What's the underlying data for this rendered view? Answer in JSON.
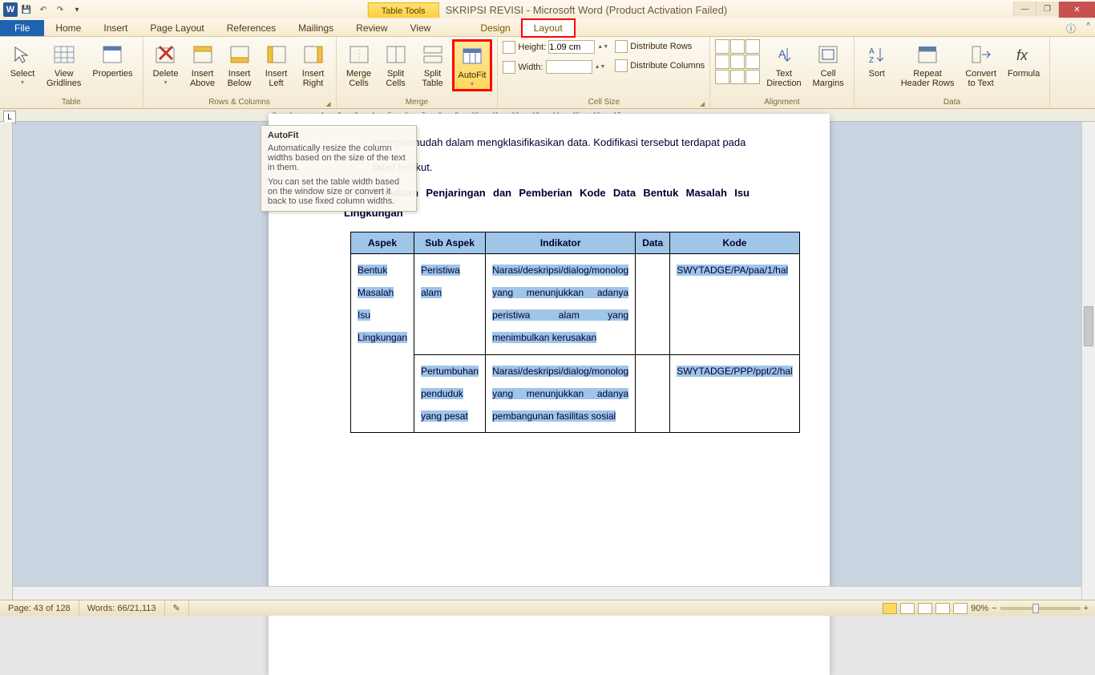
{
  "titlebar": {
    "table_tools": "Table Tools",
    "doc_title": "SKRIPSI REVISI  -  Microsoft Word (Product Activation Failed)"
  },
  "tabs": {
    "file": "File",
    "home": "Home",
    "insert": "Insert",
    "page_layout": "Page Layout",
    "references": "References",
    "mailings": "Mailings",
    "review": "Review",
    "view": "View",
    "design": "Design",
    "layout": "Layout"
  },
  "ribbon": {
    "table": {
      "select": "Select",
      "view_gridlines": "View\nGridlines",
      "properties": "Properties",
      "group": "Table"
    },
    "rows_cols": {
      "delete": "Delete",
      "insert_above": "Insert\nAbove",
      "insert_below": "Insert\nBelow",
      "insert_left": "Insert\nLeft",
      "insert_right": "Insert\nRight",
      "group": "Rows & Columns"
    },
    "merge": {
      "merge_cells": "Merge\nCells",
      "split_cells": "Split\nCells",
      "split_table": "Split\nTable",
      "autofit": "AutoFit",
      "group": "Merge"
    },
    "cell_size": {
      "height_lbl": "Height:",
      "height_val": "1.09 cm",
      "width_lbl": "Width:",
      "width_val": "",
      "dist_rows": "Distribute Rows",
      "dist_cols": "Distribute Columns",
      "group": "Cell Size"
    },
    "alignment": {
      "text_direction": "Text\nDirection",
      "cell_margins": "Cell\nMargins",
      "group": "Alignment"
    },
    "data": {
      "sort": "Sort",
      "repeat_header": "Repeat\nHeader Rows",
      "convert": "Convert\nto Text",
      "formula": "Formula",
      "group": "Data"
    }
  },
  "tooltip": {
    "title": "AutoFit",
    "p1": "Automatically resize the column widths based on the size of the text in them.",
    "p2": "You can set the table width based on the window size or convert it back to use fixed column widths."
  },
  "document": {
    "para1": "mempermudah dalam mengklasifikasikan data. Kodifikasi tersebut terdapat pada",
    "para2": "tabel berikut.",
    "heading": "3.3.1 Panduan Penjaringan dan Pemberian Kode Data Bentuk Masalah Isu Lingkungan",
    "headers": {
      "aspek": "Aspek",
      "sub": "Sub Aspek",
      "indikator": "Indikator",
      "data": "Data",
      "kode": "Kode"
    },
    "rows": [
      {
        "aspek": "Bentuk Masalah Isu Lingkungan",
        "sub": "Peristiwa alam",
        "indikator": "Narasi/deskripsi/dialog/monolog yang menunjukkan adanya peristiwa alam yang menimbulkan kerusakan",
        "data": "",
        "kode": "SWYTADGE/PA/paa/1/hal"
      },
      {
        "aspek": "",
        "sub": "Pertumbuhan penduduk yang pesat",
        "indikator": "Narasi/deskripsi/dialog/monolog yang menunjukkan adanya pembangunan fasilitas sosial",
        "data": "",
        "kode": "SWYTADGE/PPP/ppt/2/hal"
      }
    ]
  },
  "statusbar": {
    "page": "Page: 43 of 128",
    "words": "Words: 66/21,113",
    "lang_icon": "",
    "zoom": "90%"
  }
}
